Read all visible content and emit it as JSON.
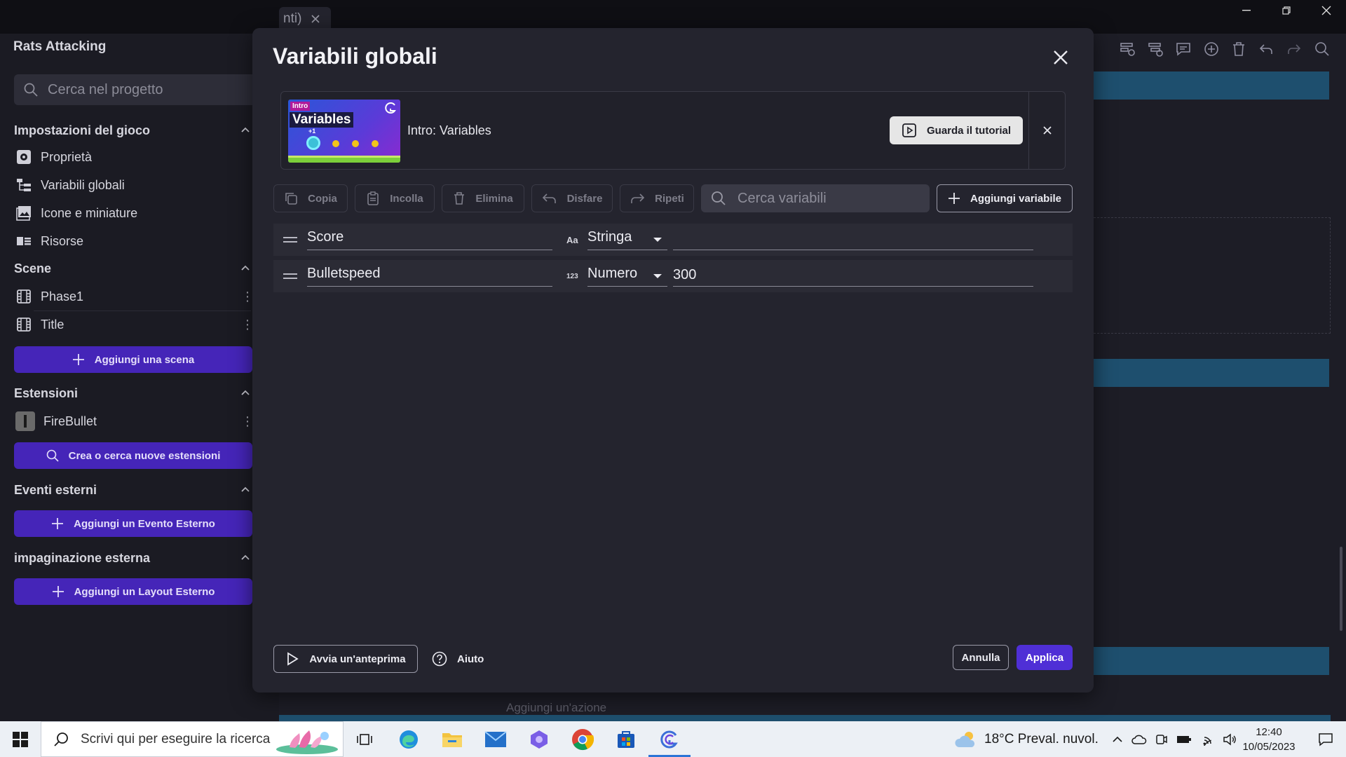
{
  "background": {
    "tab_label": "nti)",
    "sidebar": {
      "project_title": "Rats Attacking",
      "search_placeholder": "Cerca nel progetto",
      "sections": {
        "game_settings": "Impostazioni del gioco",
        "scenes": "Scene",
        "extensions": "Estensioni",
        "external_events": "Eventi esterni",
        "external_layouts": "impaginazione esterna"
      },
      "settings_items": [
        "Proprietà",
        "Variabili globali",
        "Icone e miniature",
        "Risorse"
      ],
      "scenes": [
        "Phase1",
        "Title"
      ],
      "add_scene": "Aggiungi una scena",
      "extensions": [
        "FireBullet"
      ],
      "find_extensions": "Crea o cerca nuove estensioni",
      "add_external_event": "Aggiungi un Evento Esterno",
      "add_external_layout": "Aggiungi un Layout Esterno"
    },
    "action_placeholder": "Aggiungi un'azione"
  },
  "modal": {
    "title": "Variabili globali",
    "tutorial": {
      "thumb_tag": "Intro",
      "thumb_title": "Variables",
      "thumb_plus": "+1",
      "label": "Intro: Variables",
      "watch_button": "Guarda il tutorial"
    },
    "toolbar": {
      "copy": "Copia",
      "paste": "Incolla",
      "delete": "Elimina",
      "undo": "Disfare",
      "redo": "Ripeti",
      "search_placeholder": "Cerca variabili",
      "add_variable": "Aggiungi variabile"
    },
    "variables": [
      {
        "name": "Score",
        "type_icon": "Aa",
        "type": "Stringa",
        "value": ""
      },
      {
        "name": "Bulletspeed",
        "type_icon": "123",
        "type": "Numero",
        "value": "300"
      }
    ],
    "footer": {
      "preview": "Avvia un'anteprima",
      "help": "Aiuto",
      "cancel": "Annulla",
      "apply": "Applica"
    }
  },
  "taskbar": {
    "search_placeholder": "Scrivi qui per eseguire la ricerca",
    "weather": "18°C  Preval. nuvol.",
    "time": "12:40",
    "date": "10/05/2023"
  },
  "colors": {
    "accent_purple": "#4f2fd6",
    "sidebar_button": "#4525b8",
    "modal_bg": "#24242e",
    "event_bar_blue": "#1e4f6e"
  }
}
